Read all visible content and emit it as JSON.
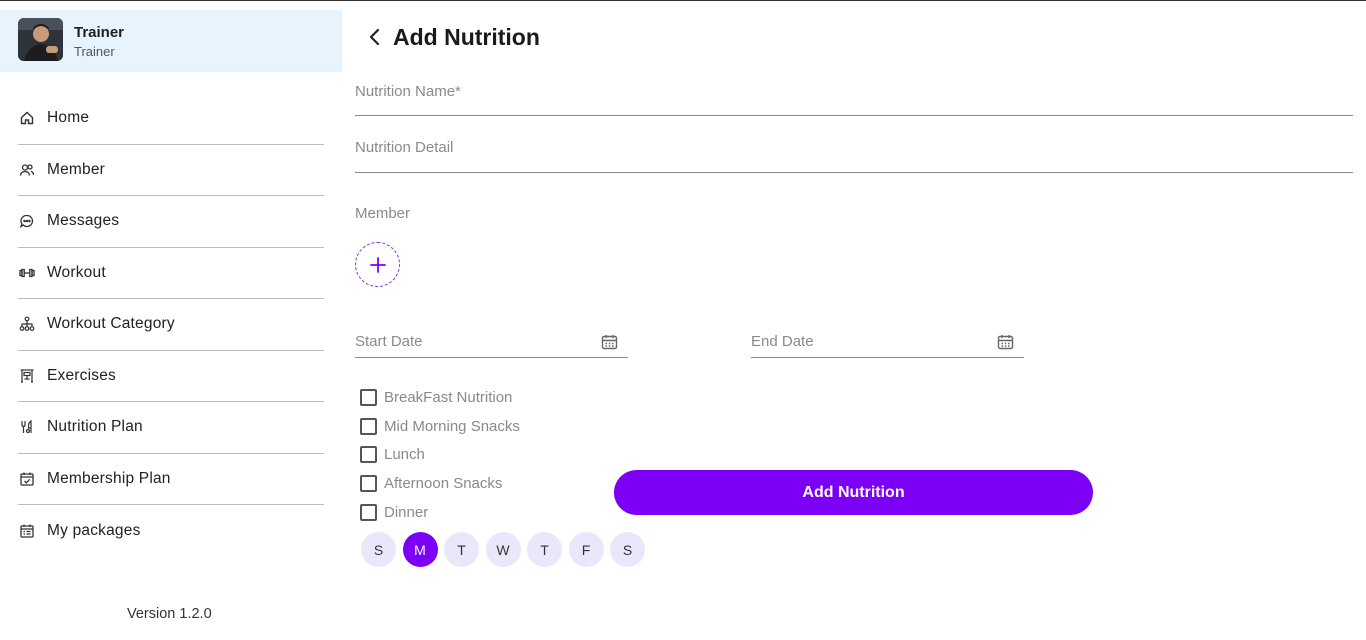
{
  "profile": {
    "name": "Trainer",
    "role": "Trainer"
  },
  "sidebar": {
    "items": [
      {
        "label": "Home",
        "icon": "home-icon"
      },
      {
        "label": "Member",
        "icon": "users-icon"
      },
      {
        "label": "Messages",
        "icon": "chat-icon"
      },
      {
        "label": "Workout",
        "icon": "dumbbell-icon"
      },
      {
        "label": "Workout Category",
        "icon": "hierarchy-icon"
      },
      {
        "label": "Exercises",
        "icon": "gym-machine-icon"
      },
      {
        "label": "Nutrition Plan",
        "icon": "nutrition-icon"
      },
      {
        "label": "Membership Plan",
        "icon": "calendar-check-icon"
      },
      {
        "label": "My packages",
        "icon": "calendar-list-icon"
      }
    ],
    "version": "Version 1.2.0"
  },
  "main": {
    "title": "Add Nutrition",
    "nutrition_name_placeholder": "Nutrition Name*",
    "nutrition_detail_placeholder": "Nutrition Detail",
    "member_label": "Member",
    "start_date_placeholder": "Start Date",
    "end_date_placeholder": "End Date",
    "meals": [
      "BreakFast Nutrition",
      "Mid Morning Snacks",
      "Lunch",
      "Afternoon Snacks",
      "Dinner"
    ],
    "days": [
      {
        "label": "S",
        "selected": false
      },
      {
        "label": "M",
        "selected": true
      },
      {
        "label": "T",
        "selected": false
      },
      {
        "label": "W",
        "selected": false
      },
      {
        "label": "T",
        "selected": false
      },
      {
        "label": "F",
        "selected": false
      },
      {
        "label": "S",
        "selected": false
      }
    ],
    "submit_label": "Add Nutrition"
  },
  "colors": {
    "accent": "#7b00f5",
    "profile_bg": "#e8f4fd",
    "day_bg": "#ece6fb"
  }
}
